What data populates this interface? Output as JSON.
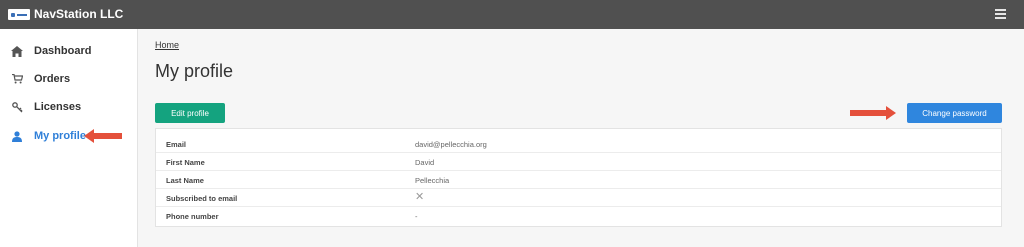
{
  "header": {
    "company": "NavStation LLC"
  },
  "sidebar": {
    "items": [
      {
        "label": "Dashboard",
        "icon": "home-icon"
      },
      {
        "label": "Orders",
        "icon": "cart-icon"
      },
      {
        "label": "Licenses",
        "icon": "key-icon"
      },
      {
        "label": "My profile",
        "icon": "user-icon",
        "active": true
      }
    ]
  },
  "breadcrumb": "Home",
  "page": {
    "title": "My profile"
  },
  "buttons": {
    "edit": "Edit profile",
    "change_password": "Change password"
  },
  "profile": {
    "rows": [
      {
        "key": "Email",
        "value": "david@pellecchia.org"
      },
      {
        "key": "First Name",
        "value": "David"
      },
      {
        "key": "Last Name",
        "value": "Pellecchia"
      },
      {
        "key": "Subscribed to email",
        "value": "✕"
      },
      {
        "key": "Phone number",
        "value": "-"
      }
    ]
  },
  "colors": {
    "accent": "#2f86de",
    "success": "#14a37f",
    "arrow": "#e4503b",
    "topbar": "#505050"
  }
}
